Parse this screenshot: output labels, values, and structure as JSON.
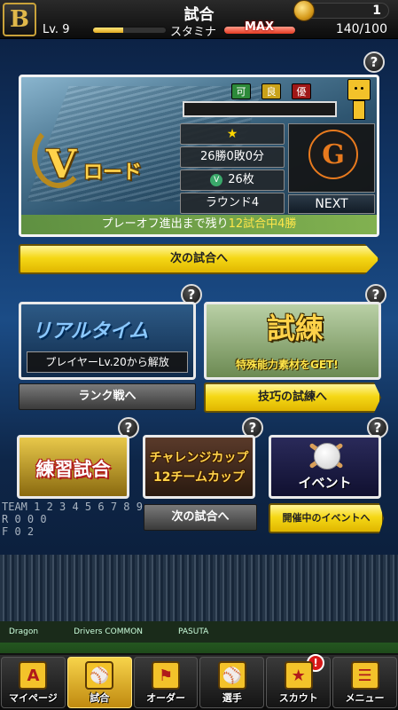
{
  "header": {
    "logo_letter": "B",
    "title": "試合",
    "coins": "1",
    "level": "Lv. 9",
    "level_progress": 0.42,
    "stamina_label": "スタミナ",
    "stamina_max_label": "MAX",
    "stamina_value": "140/100"
  },
  "vroad": {
    "grades": [
      "可",
      "良",
      "優"
    ],
    "v_letter": "V",
    "title": "ロード",
    "star": "★",
    "record": "26勝0敗0分",
    "tickets": "26枚",
    "round": "ラウンド4",
    "team_emblem": "G",
    "next_label": "NEXT",
    "playoff_prefix": "プレーオフ進出まで残り",
    "playoff_highlight": "12試合中4勝",
    "next_match_button": "次の試合へ",
    "help": "?"
  },
  "modes": {
    "realtime": {
      "title": "リアルタイム",
      "lock_text": "プレイヤーLv.20から解放",
      "button": "ランク戦へ"
    },
    "shiren": {
      "title": "試練",
      "subtitle": "特殊能力素材をGET!",
      "button": "技巧の試練へ"
    },
    "renshu": {
      "title": "練習試合"
    },
    "challenge": {
      "title_line1": "チャレンジカップ",
      "title_line2": "12チームカップ",
      "button": "次の試合へ"
    },
    "event": {
      "title": "イベント",
      "button": "開催中のイベントへ"
    },
    "help": "?"
  },
  "scoreboard": {
    "row1": "TEAM 1 2 3 4 5 6 7 8 9",
    "row2": "R   0 0 0",
    "row3": "F   0 2"
  },
  "ads": [
    "Dragon",
    "Drivers COMMON",
    "PASUTA"
  ],
  "nav": {
    "items": [
      {
        "label": "マイページ",
        "icon": "A"
      },
      {
        "label": "試合",
        "icon": "⚾"
      },
      {
        "label": "オーダー",
        "icon": "⚑"
      },
      {
        "label": "選手",
        "icon": "⚾"
      },
      {
        "label": "スカウト",
        "icon": "★"
      },
      {
        "label": "メニュー",
        "icon": "☰"
      }
    ],
    "notification_badge": "!"
  }
}
